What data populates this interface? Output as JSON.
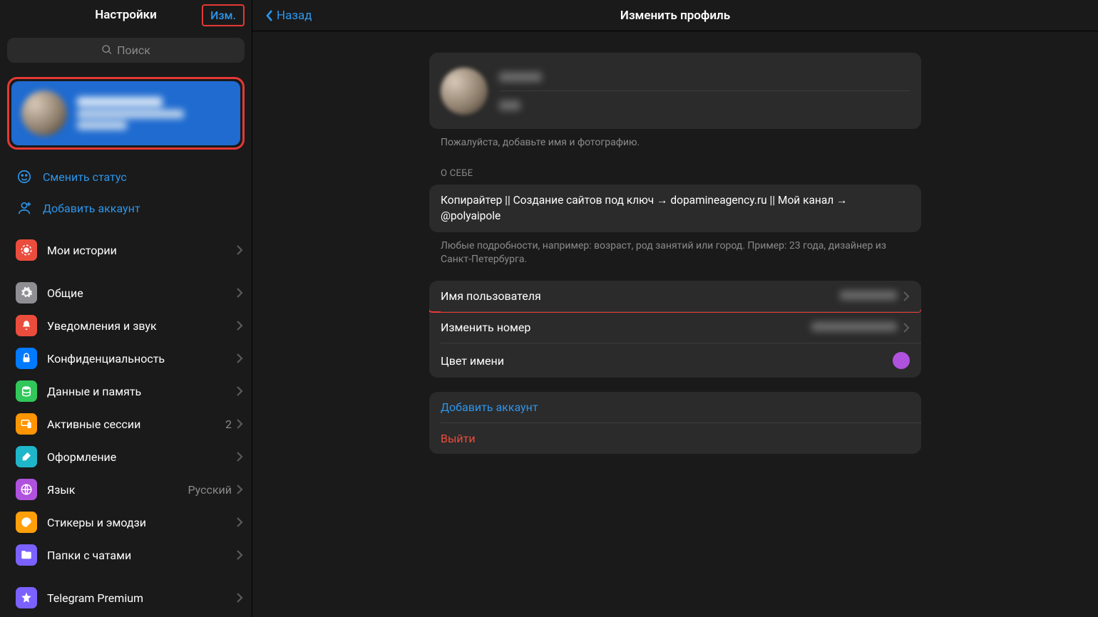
{
  "sidebar": {
    "title": "Настройки",
    "edit": "Изм.",
    "search_placeholder": "Поиск",
    "status_action": "Сменить статус",
    "add_account_action": "Добавить аккаунт",
    "items": [
      {
        "label": "Мои истории",
        "icon": "stories",
        "color": "bg-red"
      },
      {
        "label": "Общие",
        "icon": "gear",
        "color": "bg-gray"
      },
      {
        "label": "Уведомления и звук",
        "icon": "bell",
        "color": "bg-redn"
      },
      {
        "label": "Конфиденциальность",
        "icon": "lock",
        "color": "bg-blue"
      },
      {
        "label": "Данные и память",
        "icon": "db",
        "color": "bg-green"
      },
      {
        "label": "Активные сессии",
        "icon": "device",
        "color": "bg-orange",
        "value": "2"
      },
      {
        "label": "Оформление",
        "icon": "brush",
        "color": "bg-teal"
      },
      {
        "label": "Язык",
        "icon": "globe",
        "color": "bg-purple",
        "value": "Русский"
      },
      {
        "label": "Стикеры и эмодзи",
        "icon": "sticker",
        "color": "bg-yellow"
      },
      {
        "label": "Папки с чатами",
        "icon": "folder",
        "color": "bg-violet"
      },
      {
        "label": "Telegram Premium",
        "icon": "star",
        "color": "bg-star"
      }
    ]
  },
  "main": {
    "back": "Назад",
    "title": "Изменить профиль",
    "name_hint": "Пожалуйста, добавьте имя и фотографию.",
    "about_title": "О СЕБЕ",
    "bio": "Копирайтер || Создание сайтов под ключ → dopamineagency.ru || Мой канал → @polyaipole",
    "bio_hint": "Любые подробности, например: возраст, род занятий или город. Пример: 23 года, дизайнер из Санкт-Петербурга.",
    "username_label": "Имя пользователя",
    "phone_label": "Изменить номер",
    "color_label": "Цвет имени",
    "name_color": "#af52de",
    "add_account": "Добавить аккаунт",
    "logout": "Выйти"
  }
}
